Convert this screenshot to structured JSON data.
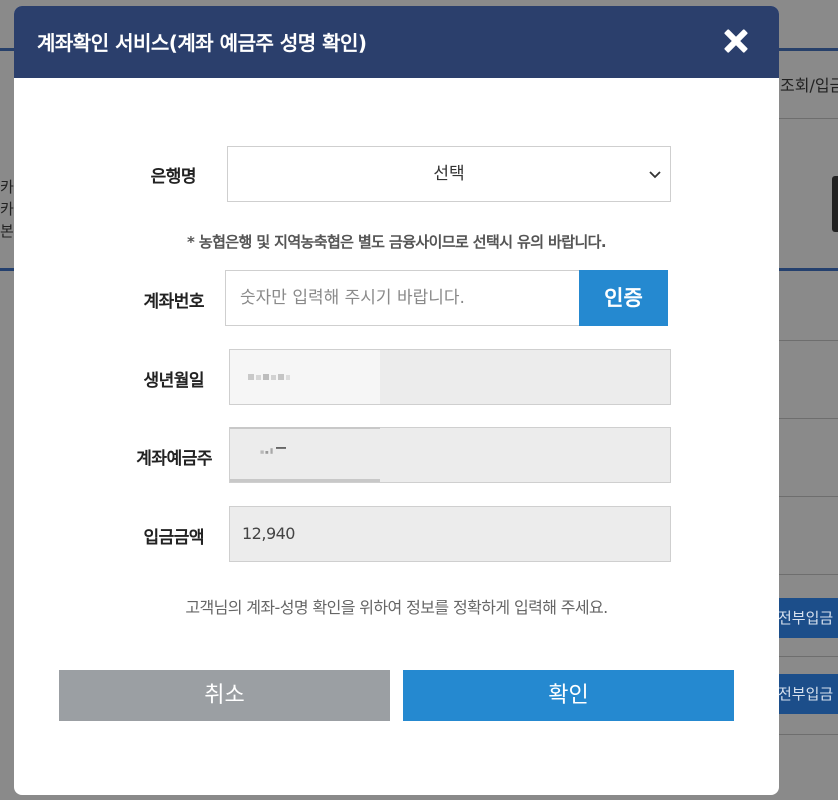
{
  "background": {
    "tab_text": "조회/입금",
    "left_texts": [
      "카드",
      "카드",
      "본인"
    ],
    "pay_buttons": [
      "전부입금",
      "전부입금"
    ]
  },
  "modal": {
    "title": "계좌확인 서비스(계좌 예금주 성명 확인)",
    "bank": {
      "label": "은행명",
      "selected": "선택"
    },
    "notice": "* 농협은행 및 지역농축협은 별도 금융사이므로 선택시 유의 바랍니다.",
    "account": {
      "label": "계좌번호",
      "placeholder": "숫자만 입력해 주시기 바랍니다.",
      "value": "",
      "auth_label": "인증"
    },
    "birth": {
      "label": "생년월일"
    },
    "holder": {
      "label": "계좌예금주"
    },
    "amount": {
      "label": "입금금액",
      "value": "12,940"
    },
    "helper": "고객님의 계좌-성명 확인을 위하여 정보를 정확하게 입력해 주세요.",
    "cancel_label": "취소",
    "confirm_label": "확인"
  },
  "colors": {
    "header": "#2b3f6c",
    "primary": "#2589d0",
    "cancel": "#9b9fa3",
    "readonly_bg": "#ececec"
  }
}
